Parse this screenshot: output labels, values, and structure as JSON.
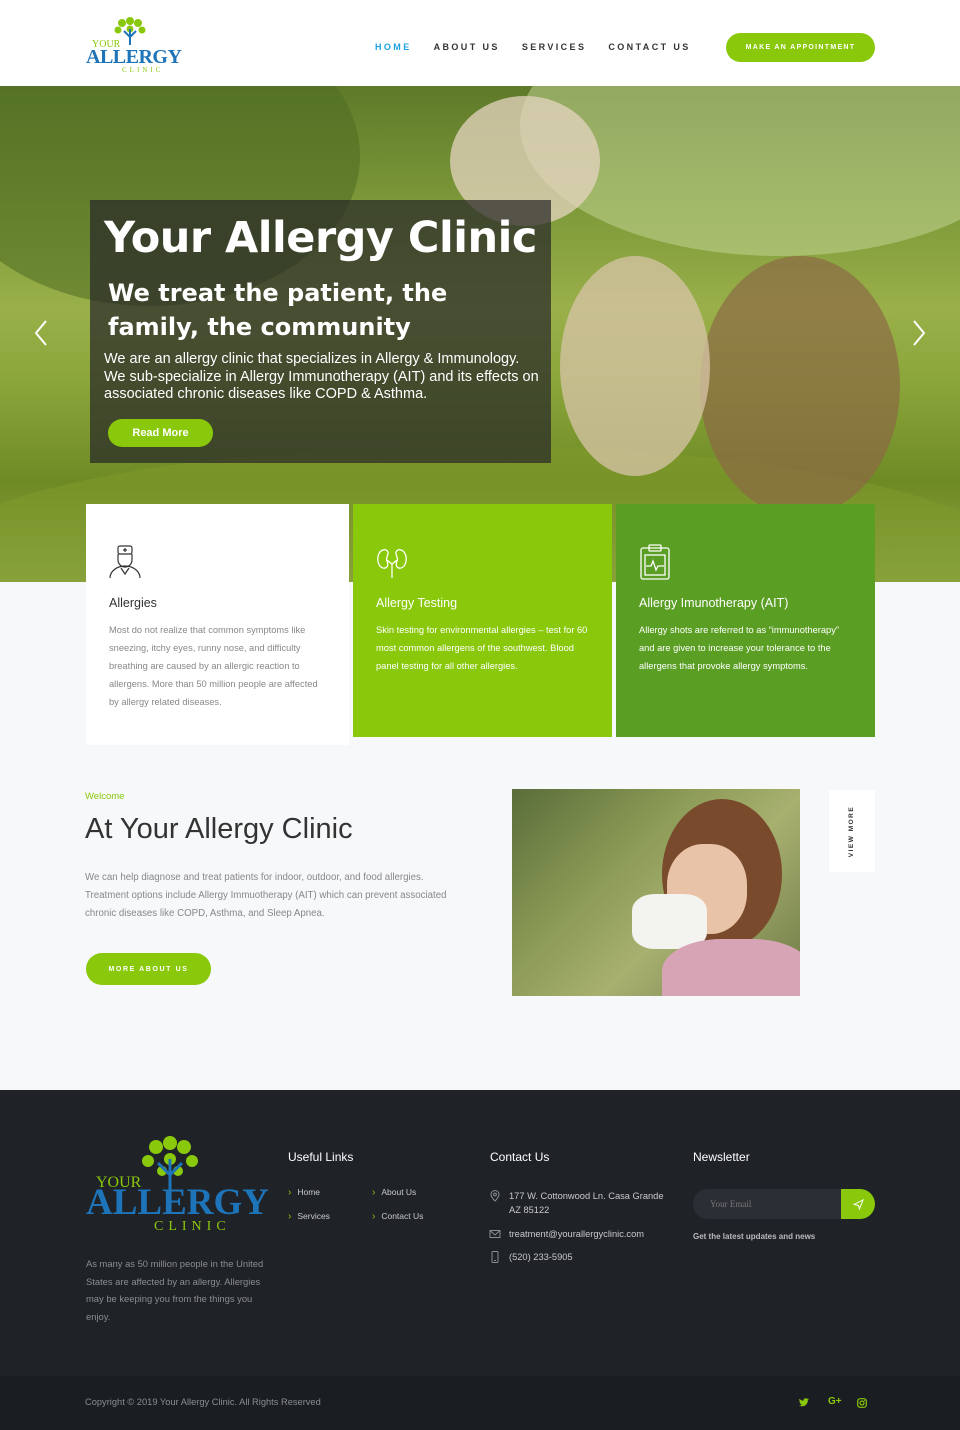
{
  "header": {
    "logo_your": "YOUR",
    "logo_allergy": "ALLERGY",
    "logo_clinic": "CLINIC",
    "nav": [
      {
        "label": "HOME"
      },
      {
        "label": "ABOUT US"
      },
      {
        "label": "SERVICES"
      },
      {
        "label": "CONTACT US"
      }
    ],
    "cta_label": "MAKE AN APPOINTMENT"
  },
  "hero": {
    "title": "Your Allergy Clinic",
    "subtitle": "We treat the patient, the family, the community",
    "description": "We are an allergy clinic that specializes in Allergy & Immunology. We sub-specialize in Allergy Immunotherapy (AIT) and its effects on associated chronic diseases like COPD & Asthma.",
    "button_label": "Read More",
    "prev_icon": "chevron-left-icon",
    "next_icon": "chevron-right-icon"
  },
  "services": [
    {
      "icon": "doctor-icon",
      "title": "Allergies",
      "text": "Most do not realize that common symptoms like sneezing, itchy eyes, runny nose, and difficulty breathing are caused by an allergic reaction to allergens. More than 50 million people are affected by allergy related diseases."
    },
    {
      "icon": "kidneys-icon",
      "title": "Allergy Testing",
      "text": "Skin testing for environmental allergies – test for 60 most common allergens of the southwest. Blood panel testing for all other allergies."
    },
    {
      "icon": "clipboard-pulse-icon",
      "title": "Allergy Imunotherapy (AIT)",
      "text": "Allergy shots are referred to as “immunotherapy” and are given to increase your tolerance to the allergens that provoke allergy symptoms."
    }
  ],
  "welcome": {
    "eyebrow": "Welcome",
    "title": "At Your Allergy Clinic",
    "text": "We can help diagnose and treat patients for indoor, outdoor, and food allergies. Treatment options include Allergy Immuotherapy (AIT) which can prevent associated chronic diseases like COPD, Asthma, and Sleep Apnea.",
    "button_label": "MORE ABOUT US",
    "view_more": "VIEW MORE"
  },
  "footer": {
    "about": "As many as 50 million people in the United States are affected by an allergy. Allergies may be keeping you from the things you enjoy.",
    "useful_links_heading": "Useful Links",
    "links": [
      {
        "label": "Home"
      },
      {
        "label": "About Us"
      },
      {
        "label": "Services"
      },
      {
        "label": "Contact Us"
      }
    ],
    "contact_heading": "Contact Us",
    "address": "177 W. Cottonwood Ln. Casa Grande AZ 85122",
    "email": "treatment@yourallergyclinic.com",
    "phone": "(520) 233-5905",
    "newsletter_heading": "Newsletter",
    "email_placeholder": "Your Email",
    "newsletter_note": "Get the latest updates and news"
  },
  "copyright": {
    "text": "Copyright © 2019 Your Allergy Clinic. All Rights Reserved",
    "social": [
      {
        "icon": "twitter-icon",
        "glyph": "🐦"
      },
      {
        "icon": "google-plus-icon",
        "glyph": "G+"
      },
      {
        "icon": "instagram-icon",
        "glyph": "◎"
      }
    ]
  },
  "colors": {
    "accent_green": "#8ac80b",
    "dark_green": "#5a9e23",
    "nav_active_blue": "#1ea3e0",
    "footer_bg": "#1f2227"
  }
}
